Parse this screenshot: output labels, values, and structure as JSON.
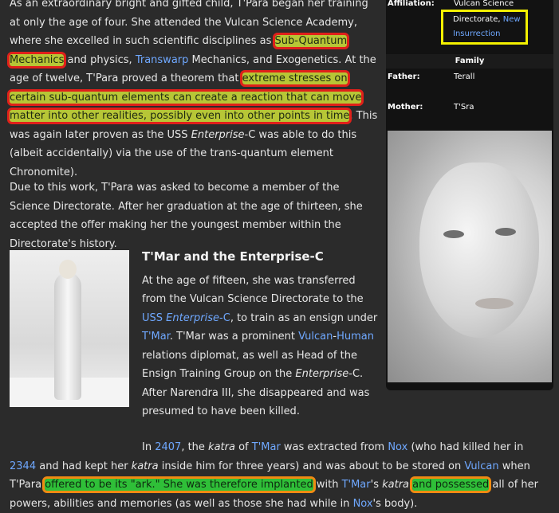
{
  "p1": {
    "a": "As an extraordinary bright and gifted child, T'Para began her training at only the age of four. She attended the Vulcan Science Academy, where she excelled in such scientific disciplines as ",
    "hl1": "Sub-Quantum Mechanics",
    "b": " and physics, ",
    "link_transwarp": "Transwarp",
    "c": " Mechanics, and Exogenetics. At the age of twelve, T'Para proved a theorem that ",
    "hl2": "extreme stresses on certain sub-quantum elements can create a reaction that can move matter into other realities, possibly even into other points in time",
    "d": ". This was again later proven as the USS ",
    "enterprise": "Enterprise",
    "e": "-C was able to do this (albeit accidentally) via the use of the trans-quantum element Chronomite)."
  },
  "p2": "Due to this work, T'Para was asked to become a member of the Science Directorate. After her graduation at the age of thirteen, she accepted the offer making her the youngest member within the Directorate's history.",
  "sec2": {
    "heading": "T'Mar and the Enterprise-C",
    "a": "At the age of fifteen, she was transferred from the Vulcan Science Directorate to the ",
    "link_uss": "USS ",
    "link_uss_ital": "Enterprise",
    "link_uss_c": "-C",
    "b": ", to train as an ensign under ",
    "link_tmar": "T'Mar",
    "c": ". T'Mar was a prominent ",
    "link_vulcan": "Vulcan",
    "dash": "-",
    "link_human": "Human",
    "d": " relations diplomat, as well as Head of the Ensign Training Group on the ",
    "enterprise": "Enterprise",
    "e": "-C. After Narendra III, she disappeared and was presumed to have been killed."
  },
  "p4": {
    "a": "In ",
    "link_2407": "2407",
    "b": ", the ",
    "katra": "katra",
    "c": " of ",
    "link_tmar": "T'Mar",
    "d": " was extracted from ",
    "link_nox": "Nox",
    "e": " (who had killed her in ",
    "link_2344": "2344",
    "f": " and had kept her ",
    "katra2": "katra",
    "g": " inside him for three years) and was about to be stored on ",
    "link_vulcan": "Vulcan",
    "h": " when T'Para ",
    "hl_green1": "offered to be its \"ark.\" She was therefore implanted",
    "i": " with ",
    "link_tmar2": "T'Mar",
    "j": "'s ",
    "katra3": "katra",
    "k": " ",
    "hl_green2": "and possessed",
    "l": " all of her powers, abilities and memories (as well as those she had while in ",
    "link_nox2": "Nox",
    "m": "'s body)."
  },
  "infobox": {
    "affiliation_label": "Affiliation:",
    "affiliation_1": "Vulcan Science",
    "affiliation_2": "Directorate, ",
    "affiliation_link1": "New",
    "affiliation_link2": "Insurrection",
    "family_header": "Family",
    "father_label": "Father:",
    "father_value": "Terall",
    "mother_label": "Mother:",
    "mother_value": "T'Sra"
  }
}
